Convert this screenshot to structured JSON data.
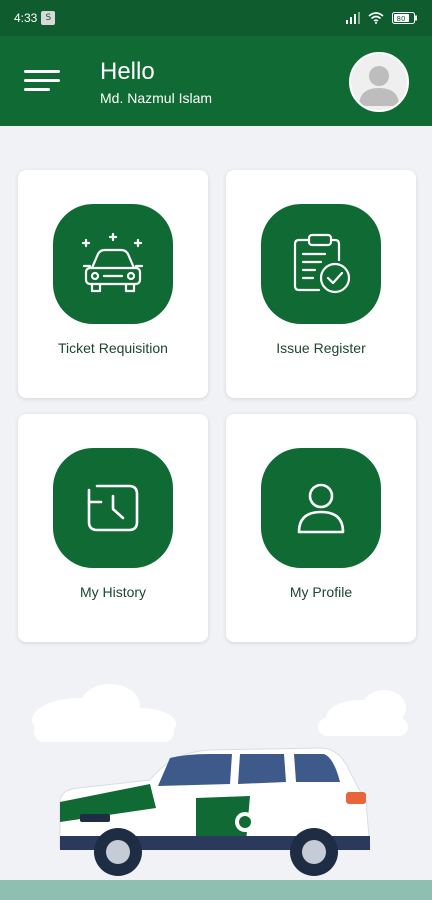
{
  "status_bar": {
    "time": "4:33",
    "notification_badge": "S",
    "battery_level": "80",
    "icons": [
      "signal-icon",
      "wifi-icon",
      "battery-icon"
    ]
  },
  "header": {
    "greeting": "Hello",
    "user_name": "Md. Nazmul Islam"
  },
  "cards": [
    {
      "label": "Ticket Requisition",
      "icon": "car-icon"
    },
    {
      "label": "Issue Register",
      "icon": "clipboard-check-icon"
    },
    {
      "label": "My History",
      "icon": "history-clock-icon"
    },
    {
      "label": "My Profile",
      "icon": "user-icon"
    }
  ],
  "colors": {
    "primary": "#0f6b33",
    "status_bar": "#0f5c2e",
    "background": "#f1f2f6",
    "label_text": "#1d4630"
  }
}
